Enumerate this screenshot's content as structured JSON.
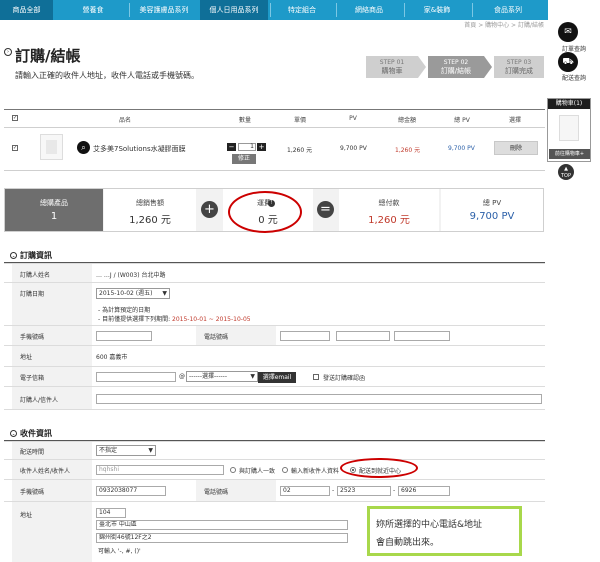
{
  "nav": {
    "items": [
      "商品全部",
      "營養食",
      "美容護膚品系列",
      "個人日用品系列",
      "特定組合",
      "網絡商品",
      "家&裝飾",
      "食品系列"
    ],
    "breadcrumb": "首頁 > 購物中心 > 訂購/結帳"
  },
  "sidebar": {
    "order_query": "訂單查詢",
    "delivery_query": "配送查詢",
    "cart_title": "購物車(1)",
    "go_cart": "前往購物車+",
    "top": "TOP"
  },
  "page": {
    "title": "訂購/結帳",
    "subtitle": "請輸入正確的收件人地址，收件人電話或手機號碼。"
  },
  "steps": [
    {
      "no": "STEP 01",
      "name": "購物車"
    },
    {
      "no": "STEP 02",
      "name": "訂購/結帳"
    },
    {
      "no": "STEP 03",
      "name": "訂購完成"
    }
  ],
  "table": {
    "headers": [
      "品名",
      "數量",
      "單價",
      "PV",
      "總金額",
      "總 PV",
      "選擇"
    ],
    "row": {
      "name": "艾多美7Solutions水凝膠面膜",
      "qty": "1",
      "modify": "修正",
      "price": "1,260 元",
      "pv": "9,700 PV",
      "total": "1,260 元",
      "total_pv": "9,700 PV",
      "delete": "刪除"
    }
  },
  "totals": {
    "count_label": "總購產品",
    "count": "1",
    "subtotal_label": "總銷售額",
    "subtotal": "1,260 元",
    "plus": "+",
    "shipping_label": "運費",
    "shipping": "0 元",
    "equals": "=",
    "payable_label": "總付款",
    "payable": "1,260 元",
    "pv_label": "總 PV",
    "pv": "9,700 PV"
  },
  "order": {
    "section": "訂購資訊",
    "name_label": "訂購人姓名",
    "name_value": "…           …J / (W003) 台北中路",
    "date_label": "訂購日期",
    "date_value": "2015-10-02 (週五)",
    "date_note1": "- 為計算預定的日期",
    "date_note2a": "- 目前僅提供選擇下列期間: ",
    "date_note2b": "2015-10-01 ~ 2015-10-05",
    "mobile_label": "手機號碼",
    "phone_label": "電話號碼",
    "address_label": "地址",
    "address_value": "600  嘉義市",
    "email_label": "電子信箱",
    "email_at": "@",
    "email_domain": "------選擇------",
    "email_btn": "選擇email",
    "email_check": "發送訂購確認函",
    "memo_label": "訂購人/信件人"
  },
  "recipient": {
    "section": "收件資訊",
    "time_label": "配送時間",
    "time_value": "不指定",
    "name_label": "收件人姓名/收件人",
    "name_value": "hqhshi",
    "opt1": "與訂購人一致",
    "opt2": "輸入新收件人資料",
    "opt3": "配送到就近中心",
    "mobile_label": "手機號碼",
    "mobile_value": "0932038077",
    "phone_label": "電話號碼",
    "phone1": "02",
    "phone2": "2523",
    "phone3": "6926",
    "address_label": "地址",
    "zip": "104",
    "addr1": "臺北市 中山區",
    "addr2": "錦州街46號12F之2",
    "addr_hint": "可輸入 '-, #, ()'"
  },
  "note": {
    "line1": "妳所選擇的中心電話&地址",
    "line2": "會自動跳出來。"
  }
}
